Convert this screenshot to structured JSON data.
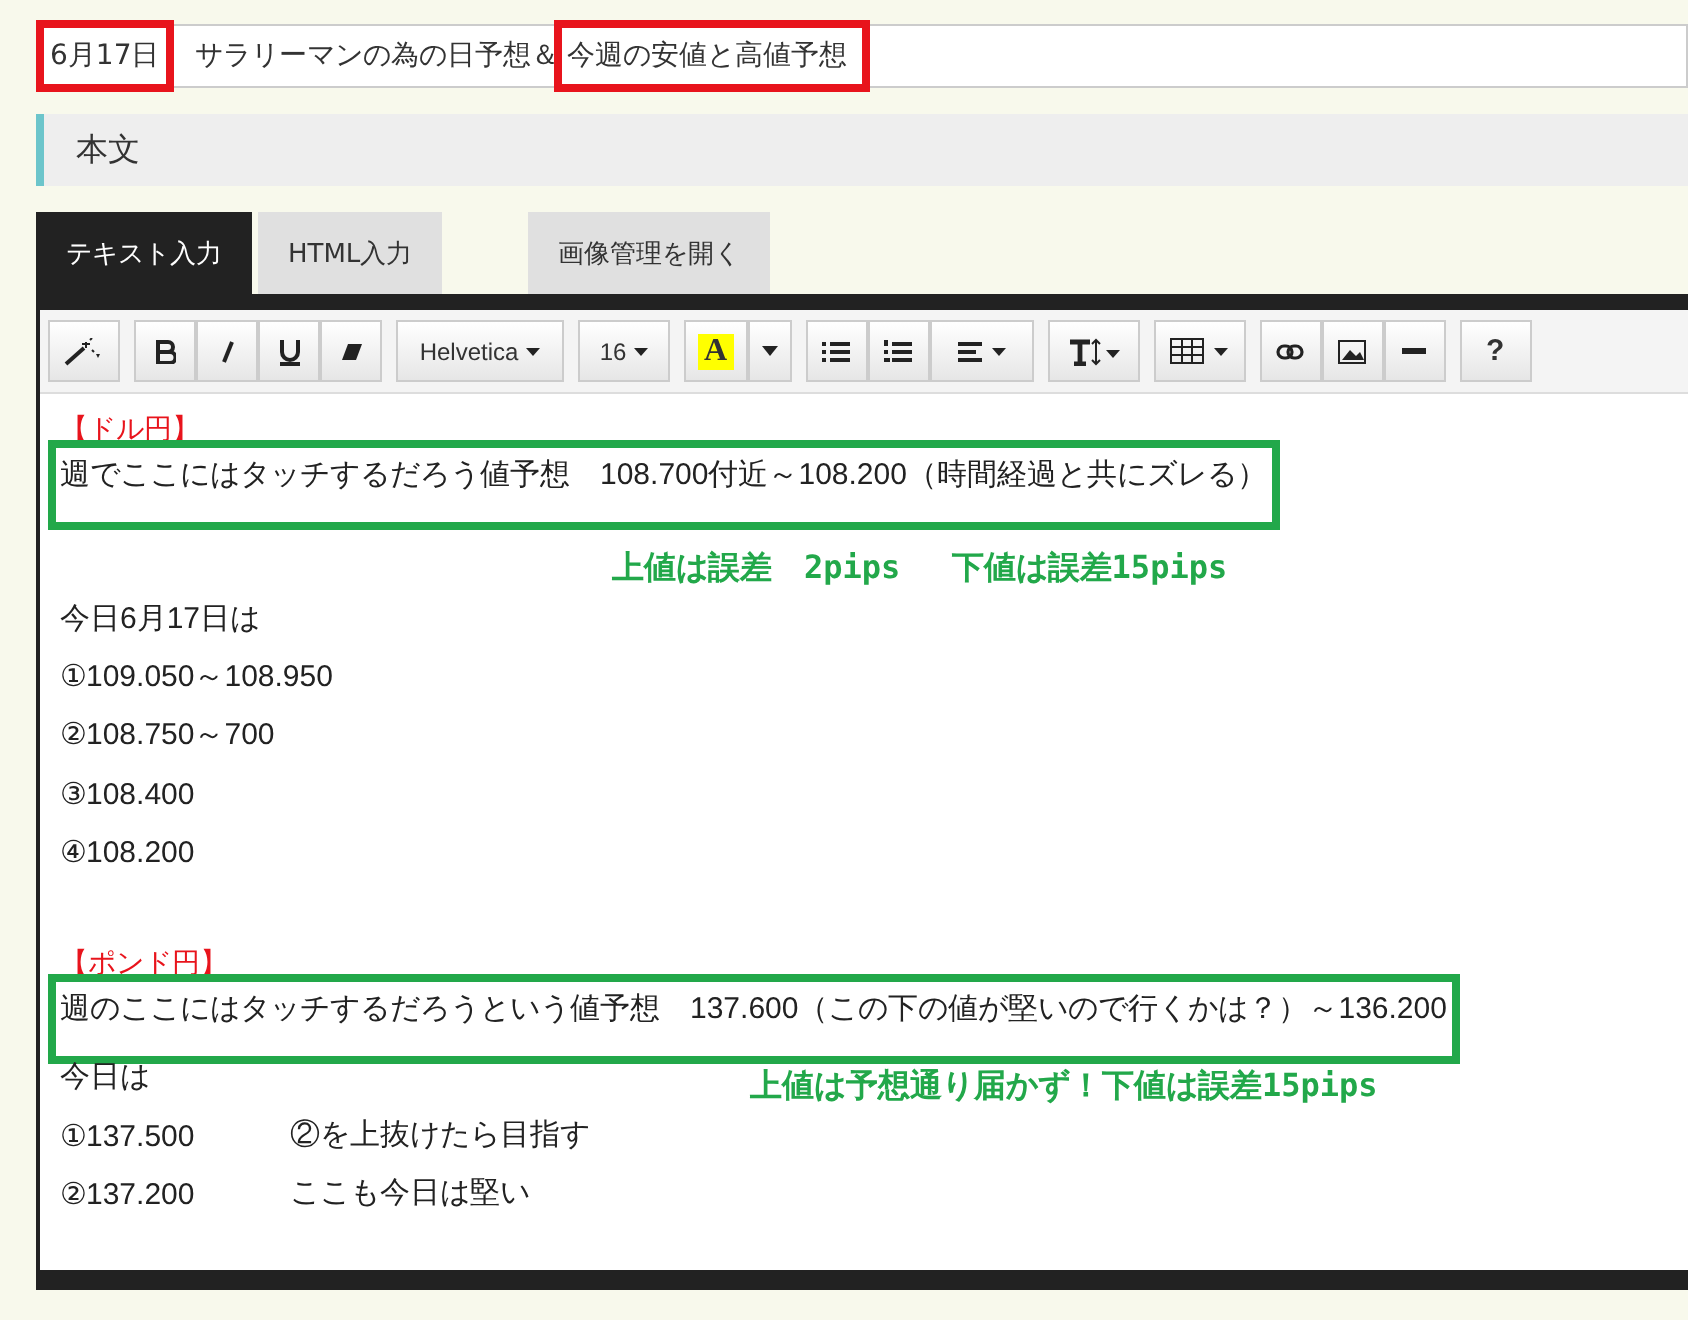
{
  "title_field": {
    "segments": [
      {
        "text": "6月17日",
        "boxed": true
      },
      {
        "text": "サラリーマンの為の日予想＆",
        "boxed": false
      },
      {
        "text": "今週の安値と高値予想",
        "boxed": true
      }
    ]
  },
  "section_header": "本文",
  "tabs": [
    {
      "label": "テキスト入力",
      "selected": true
    },
    {
      "label": "HTML入力",
      "selected": false
    }
  ],
  "image_button": "画像管理を開く",
  "toolbar": {
    "font": "Helvetica",
    "size": "16",
    "color_letter": "A",
    "help": "?"
  },
  "lines": [
    {
      "kind": "label",
      "text": "【ドル円】"
    },
    {
      "kind": "boxed",
      "text": "週でここにはタッチするだろう値予想　108.700付近～108.200（時間経過と共にズレる）"
    },
    {
      "kind": "note",
      "text": "上値は誤差　2pips　 下値は誤差15pips"
    },
    {
      "kind": "text",
      "text": "今日6月17日は"
    },
    {
      "kind": "text",
      "text": "①109.050～108.950"
    },
    {
      "kind": "text",
      "text": "②108.750～700"
    },
    {
      "kind": "text",
      "text": "③108.400"
    },
    {
      "kind": "text",
      "text": "④108.200"
    },
    {
      "kind": "blank"
    },
    {
      "kind": "label",
      "text": "【ポンド円】"
    },
    {
      "kind": "boxed",
      "text": "週のここにはタッチするだろうという値予想　137.600（この下の値が堅いので行くかは？）～136.200"
    },
    {
      "kind": "text",
      "text": "今日は",
      "note": "上値は予想通り届かず！下値は誤差15pips"
    },
    {
      "kind": "pair",
      "text": "①137.500",
      "aside": "②を上抜けたら目指す"
    },
    {
      "kind": "pair",
      "text": "②137.200",
      "aside": "ここも今日は堅い"
    }
  ]
}
